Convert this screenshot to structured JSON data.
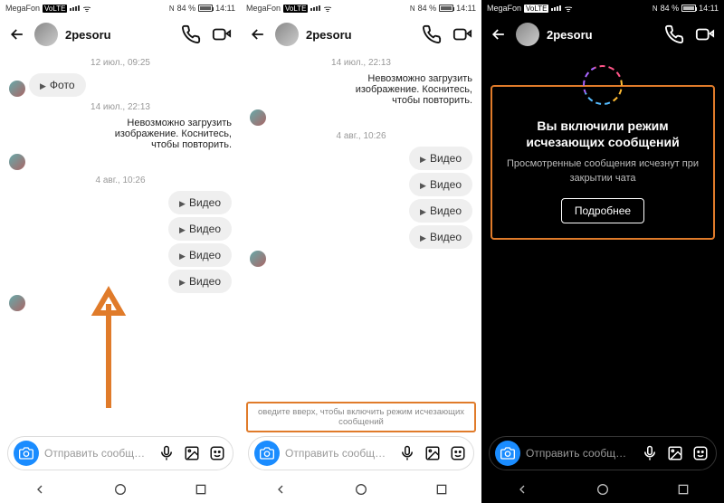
{
  "status": {
    "carrier": "MegaFon",
    "carrier_tag": "VoLTE",
    "nfc": "N",
    "battery_pct": "84 %",
    "time": "14:11"
  },
  "header": {
    "username": "2pesoru"
  },
  "pane1": {
    "ts1": "12 июл., 09:25",
    "photo_label": "Фото",
    "ts2": "14 июл., 22:13",
    "error_text": "Невозможно загрузить изображение. Коснитесь, чтобы повторить.",
    "ts3": "4 авг., 10:26",
    "video_label": "Видео"
  },
  "pane2": {
    "ts1": "14 июл., 22:13",
    "error_text": "Невозможно загрузить изображение. Коснитесь, чтобы повторить.",
    "ts2": "4 авг., 10:26",
    "video_label": "Видео",
    "swipe_hint": "оведите вверх, чтобы включить режим исчезающих сообщений"
  },
  "pane3": {
    "title": "Вы включили режим исчезающих сообщений",
    "subtitle": "Просмотренные сообщения исчезнут при закрытии чата",
    "button": "Подробнее"
  },
  "composer": {
    "placeholder": "Отправить сообщ…"
  }
}
